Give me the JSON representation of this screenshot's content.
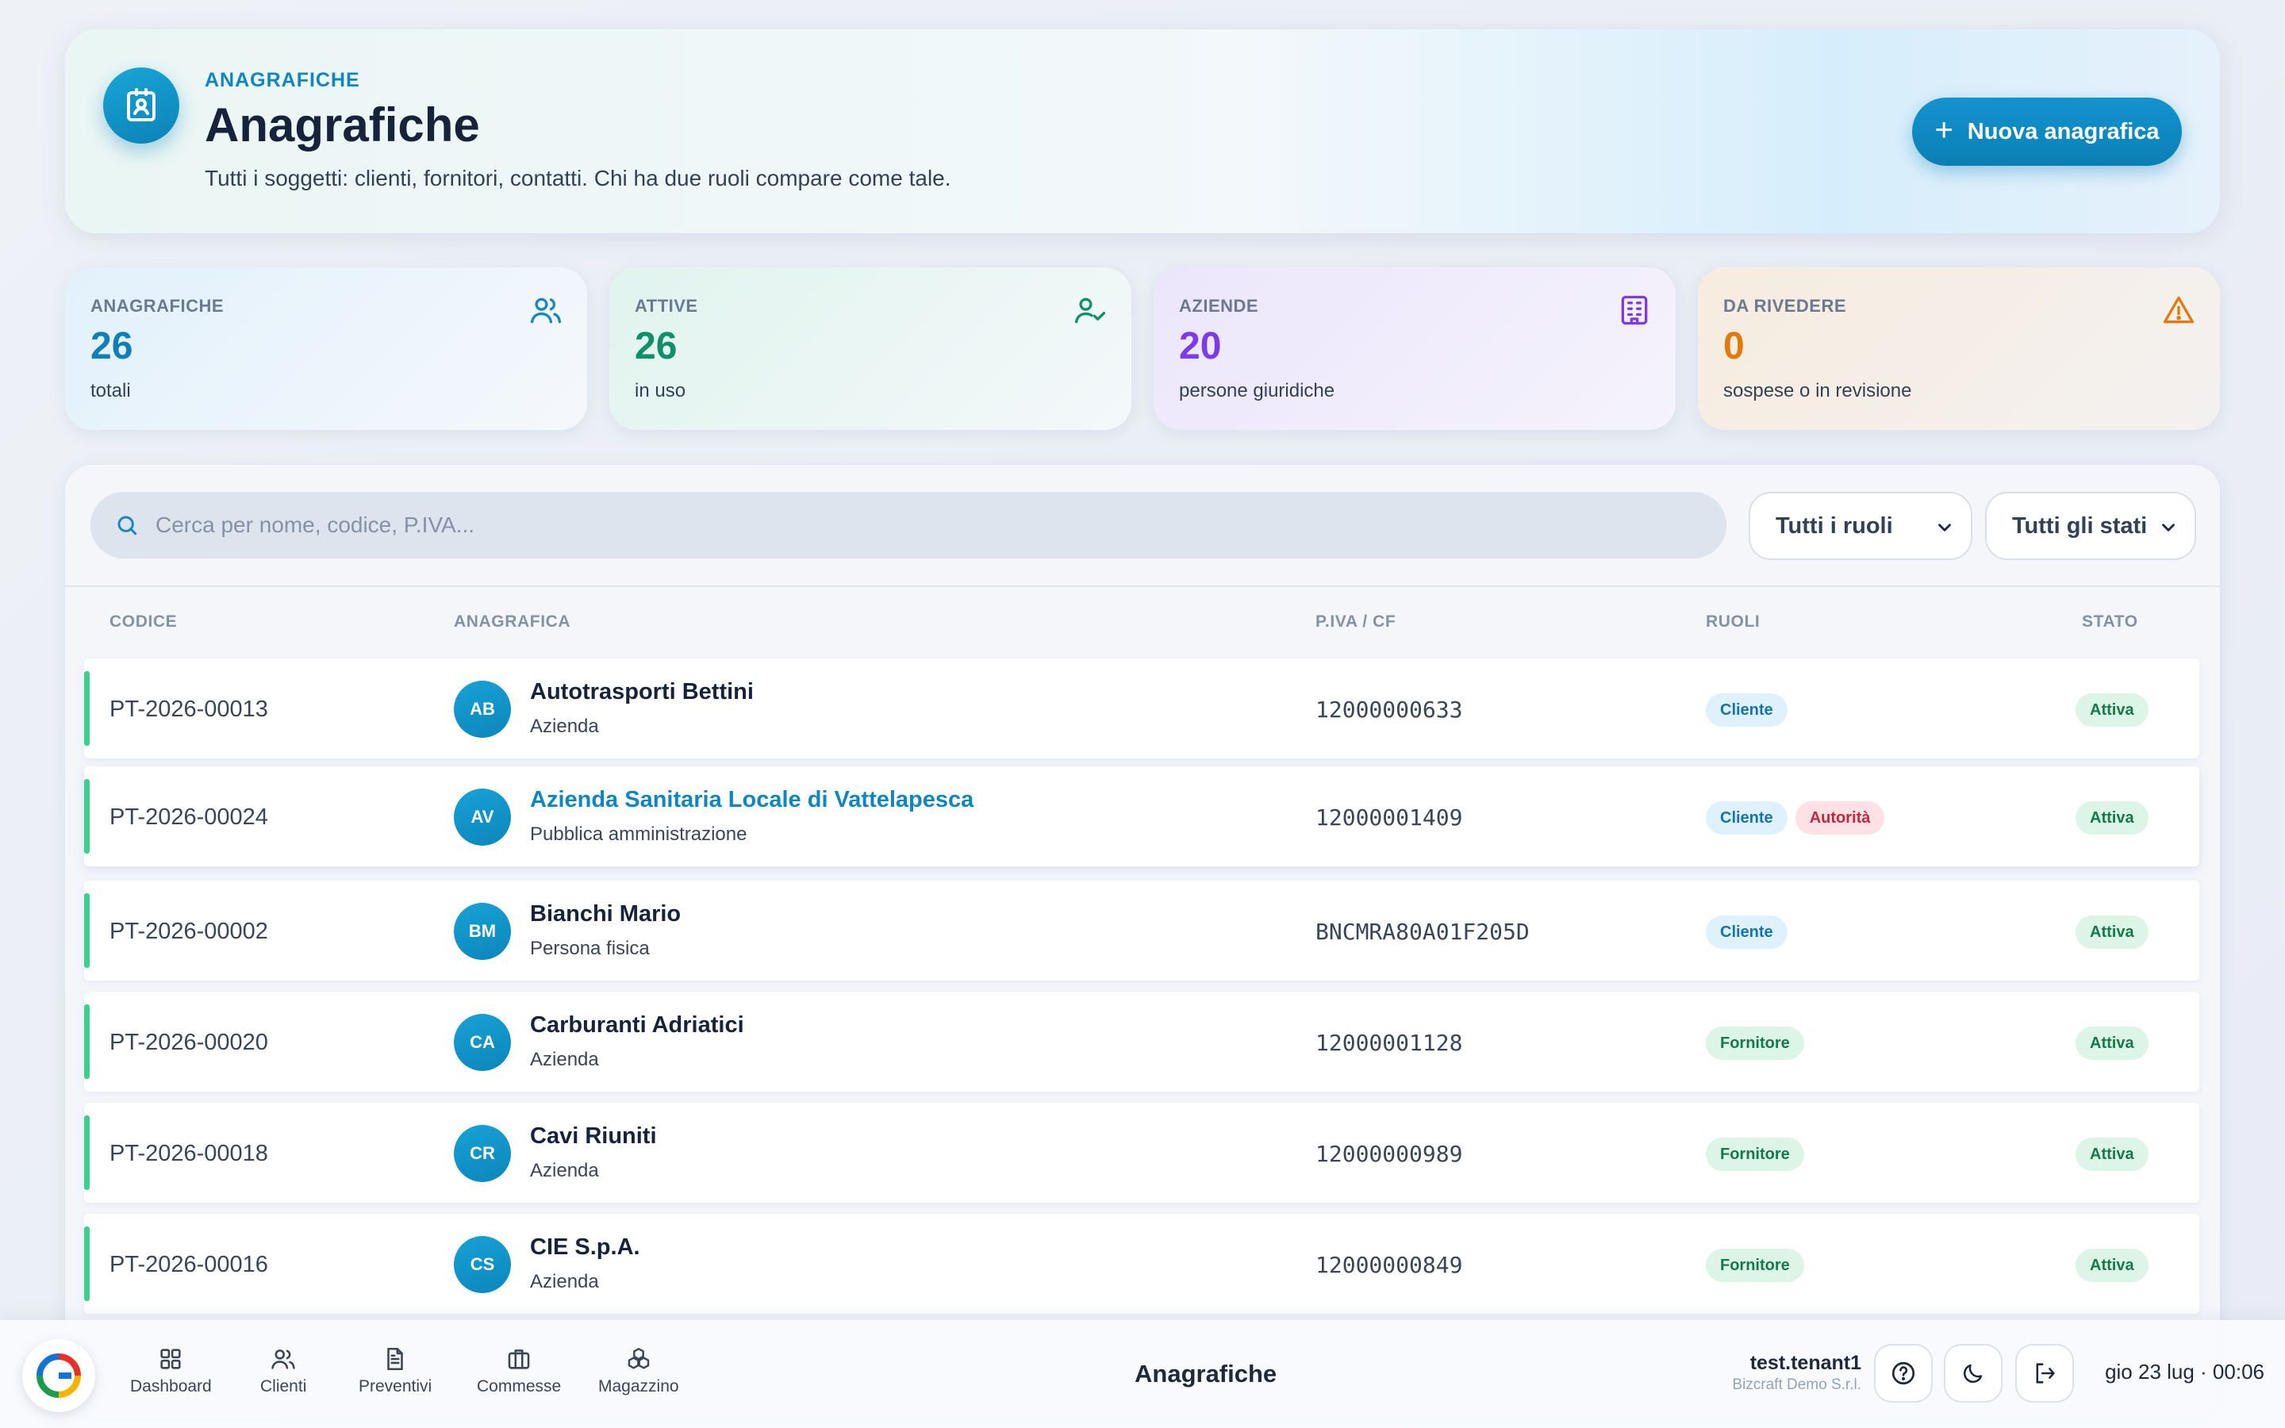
{
  "header": {
    "eyebrow": "ANAGRAFICHE",
    "title": "Anagrafiche",
    "subtitle": "Tutti i soggetti: clienti, fornitori, contatti. Chi ha due ruoli compare come tale.",
    "new_button": "Nuova anagrafica",
    "icon": "contact-card-icon"
  },
  "stats": [
    {
      "label": "ANAGRAFICHE",
      "value": "26",
      "caption": "totali",
      "icon": "users-icon"
    },
    {
      "label": "ATTIVE",
      "value": "26",
      "caption": "in uso",
      "icon": "user-check-icon"
    },
    {
      "label": "AZIENDE",
      "value": "20",
      "caption": "persone giuridiche",
      "icon": "building-icon"
    },
    {
      "label": "DA RIVEDERE",
      "value": "0",
      "caption": "sospese o in revisione",
      "icon": "warning-icon"
    }
  ],
  "filters": {
    "search_placeholder": "Cerca per nome, codice, P.IVA...",
    "roles_select": "Tutti i ruoli",
    "status_select": "Tutti gli stati"
  },
  "table": {
    "columns": [
      "CODICE",
      "ANAGRAFICA",
      "P.IVA / CF",
      "RUOLI",
      "STATO"
    ],
    "rows": [
      {
        "code": "PT-2026-00013",
        "initials": "AB",
        "name": "Autotrasporti Bettini",
        "type": "Azienda",
        "piva": "12000000633",
        "roles": [
          "Cliente"
        ],
        "status": "Attiva"
      },
      {
        "code": "PT-2026-00024",
        "initials": "AV",
        "name": "Azienda Sanitaria Locale di Vattelapesca",
        "type": "Pubblica amministrazione",
        "piva": "12000001409",
        "roles": [
          "Cliente",
          "Autorità"
        ],
        "status": "Attiva"
      },
      {
        "code": "PT-2026-00002",
        "initials": "BM",
        "name": "Bianchi Mario",
        "type": "Persona fisica",
        "piva": "BNCMRA80A01F205D",
        "roles": [
          "Cliente"
        ],
        "status": "Attiva"
      },
      {
        "code": "PT-2026-00020",
        "initials": "CA",
        "name": "Carburanti Adriatici",
        "type": "Azienda",
        "piva": "12000001128",
        "roles": [
          "Fornitore"
        ],
        "status": "Attiva"
      },
      {
        "code": "PT-2026-00018",
        "initials": "CR",
        "name": "Cavi Riuniti",
        "type": "Azienda",
        "piva": "12000000989",
        "roles": [
          "Fornitore"
        ],
        "status": "Attiva"
      },
      {
        "code": "PT-2026-00016",
        "initials": "CS",
        "name": "CIE S.p.A.",
        "type": "Azienda",
        "piva": "12000000849",
        "roles": [
          "Fornitore"
        ],
        "status": "Attiva"
      }
    ]
  },
  "bottombar": {
    "nav": [
      {
        "label": "Dashboard",
        "icon": "dashboard-icon"
      },
      {
        "label": "Clienti",
        "icon": "users-icon"
      },
      {
        "label": "Preventivi",
        "icon": "document-icon"
      },
      {
        "label": "Commesse",
        "icon": "briefcase-icon"
      },
      {
        "label": "Magazzino",
        "icon": "boxes-icon"
      }
    ],
    "page_title": "Anagrafiche",
    "username": "test.tenant1",
    "company": "Bizcraft Demo S.r.l.",
    "datetime": "gio 23 lug · 00:06"
  },
  "colors": {
    "accent": "#0f86c0",
    "active_green": "#3bd08f",
    "purple": "#7c3aed",
    "orange": "#e27a0b"
  }
}
